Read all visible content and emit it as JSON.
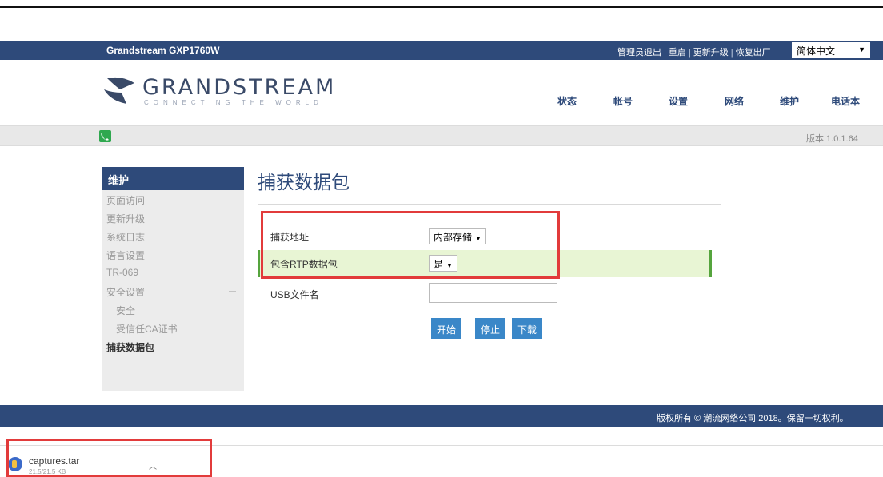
{
  "header": {
    "product": "Grandstream GXP1760W",
    "links": [
      "管理员退出",
      "重启",
      "更新升级",
      "恢复出厂"
    ],
    "language": "简体中文"
  },
  "logo": {
    "name": "GRANDSTREAM",
    "tagline": "CONNECTING THE WORLD"
  },
  "nav": [
    "状态",
    "帐号",
    "设置",
    "网络",
    "维护",
    "电话本"
  ],
  "version": "版本 1.0.1.64",
  "sidebar": {
    "heading": "维护",
    "items": [
      {
        "label": "页面访问"
      },
      {
        "label": "更新升级"
      },
      {
        "label": "系统日志"
      },
      {
        "label": "语言设置"
      },
      {
        "label": "TR-069"
      },
      {
        "label": "安全设置"
      },
      {
        "label": "安全"
      },
      {
        "label": "受信任CA证书"
      },
      {
        "label": "捕获数据包"
      }
    ]
  },
  "content": {
    "title": "捕获数据包",
    "capture_location_label": "捕获地址",
    "capture_location_value": "内部存储",
    "include_rtp_label": "包含RTP数据包",
    "include_rtp_value": "是",
    "usb_filename_label": "USB文件名",
    "usb_filename_value": "",
    "buttons": {
      "start": "开始",
      "stop": "停止",
      "download": "下载"
    }
  },
  "footer": {
    "copyright": "版权所有 © 潮流网络公司 2018。保留一切权利。"
  },
  "download": {
    "filename": "captures.tar",
    "size": "21.5/21.5 KB"
  },
  "colors": {
    "brand": "#2e4a7a",
    "button": "#3a87c8",
    "highlight_row": "#e8f5d4",
    "annotation": "#e23b3b"
  }
}
